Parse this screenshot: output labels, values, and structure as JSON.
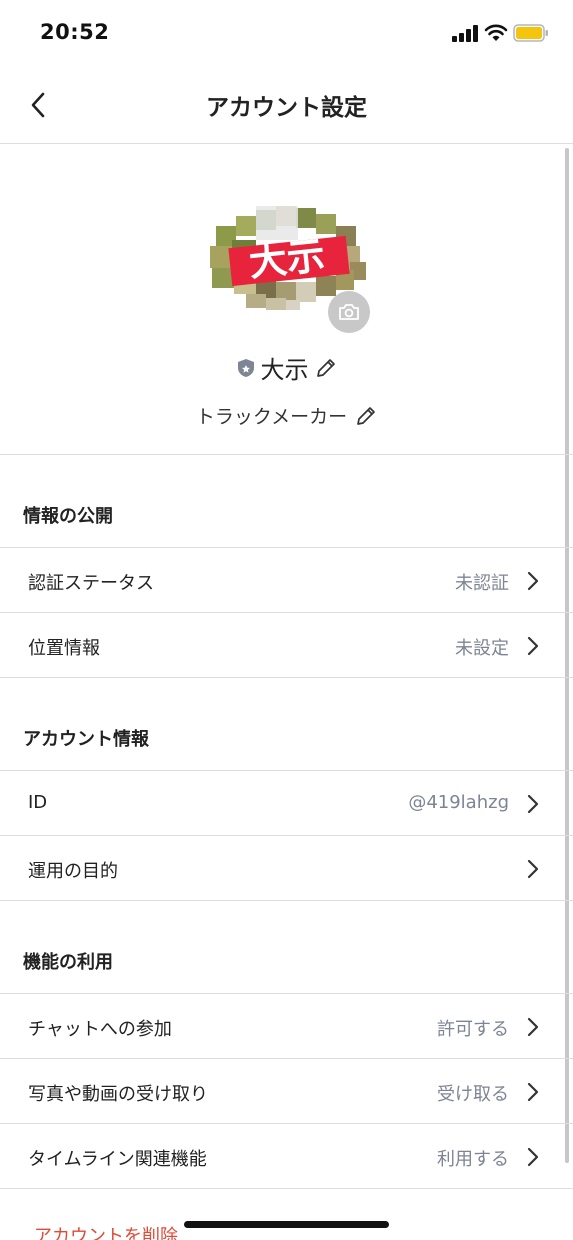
{
  "status_bar": {
    "time": "20:52",
    "battery_color": "#f5c40d"
  },
  "nav": {
    "title": "アカウント設定",
    "back_icon": "chevron-left-icon"
  },
  "profile": {
    "avatar_icon": "profile-image",
    "camera_icon": "camera-icon",
    "badge_icon": "shield-icon",
    "name": "大示",
    "status_message": "トラックメーカー",
    "edit_icon": "pencil-icon"
  },
  "sections": {
    "disclosure": {
      "title": "情報の公開",
      "items": [
        {
          "label": "認証ステータス",
          "value": "未認証"
        },
        {
          "label": "位置情報",
          "value": "未設定"
        }
      ]
    },
    "account": {
      "title": "アカウント情報",
      "items": [
        {
          "label": "ID",
          "value": "@419lahzg"
        },
        {
          "label": "運用の目的",
          "value": ""
        }
      ]
    },
    "features": {
      "title": "機能の利用",
      "items": [
        {
          "label": "チャットへの参加",
          "value": "許可する"
        },
        {
          "label": "写真や動画の受け取り",
          "value": "受け取る"
        },
        {
          "label": "タイムライン関連機能",
          "value": "利用する"
        }
      ]
    }
  },
  "delete_account": "アカウントを削除",
  "colors": {
    "accent_red": "#e04a36",
    "value_gray": "#7d8494",
    "divider": "#dedede"
  }
}
